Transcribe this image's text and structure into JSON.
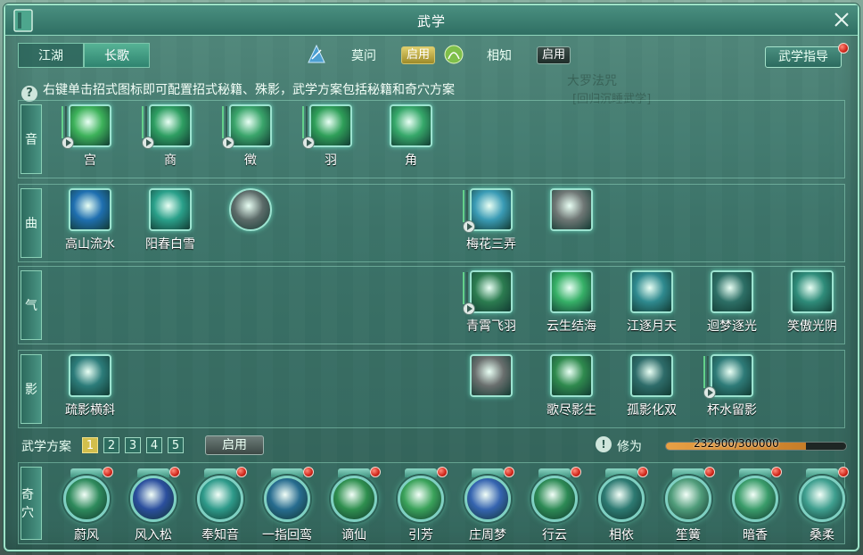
{
  "window": {
    "title": "武学"
  },
  "tabs": [
    {
      "label": "江湖",
      "active": false
    },
    {
      "label": "长歌",
      "active": true
    }
  ],
  "schools": [
    {
      "name": "莫问",
      "button": "启用",
      "state": "gold"
    },
    {
      "name": "相知",
      "button": "启用",
      "state": "dark"
    }
  ],
  "guide_button": "武学指导",
  "hint": "右键单击招式图标即可配置招式秘籍、殊影，武学方案包括秘籍和奇穴方案",
  "background_text": {
    "title": "大罗法咒",
    "subtitle": "[回归沉睡武学]"
  },
  "rows": [
    {
      "label": "音",
      "skills": [
        {
          "name": "宫",
          "icon": "hand-strum-icon",
          "color": "#3db25a"
        },
        {
          "name": "商",
          "icon": "hand-swirl-icon",
          "color": "#2e9e62"
        },
        {
          "name": "徵",
          "icon": "hand-pluck-icon",
          "color": "#3aa56b"
        },
        {
          "name": "羽",
          "icon": "hand-cross-icon",
          "color": "#2f9f59"
        },
        {
          "name": "角",
          "icon": "hand-open-icon",
          "color": "#36a86a"
        }
      ]
    },
    {
      "label": "曲",
      "skills": [
        {
          "name": "高山流水",
          "icon": "water-flow-icon",
          "color": "#1f6fb0"
        },
        {
          "name": "阳春白雪",
          "icon": "snowflake-icon",
          "color": "#2aa08a"
        },
        {
          "name": "",
          "icon": "smoke-orb-icon",
          "color": "#5c6b69"
        },
        {
          "name": "梅花三弄",
          "icon": "plum-blossom-icon",
          "color": "#3a9bb5"
        },
        {
          "name": "",
          "icon": "statue-icon",
          "color": "#6f7775"
        }
      ]
    },
    {
      "label": "气",
      "skills": [
        {
          "name": "青霄飞羽",
          "icon": "feather-icon",
          "color": "#2c7c50"
        },
        {
          "name": "云生结海",
          "icon": "green-vortex-icon",
          "color": "#36b067"
        },
        {
          "name": "江逐月天",
          "icon": "moon-burst-icon",
          "color": "#2f8a8f"
        },
        {
          "name": "迴梦逐光",
          "icon": "dream-figure-icon",
          "color": "#2d6f66"
        },
        {
          "name": "笑傲光阴",
          "icon": "wind-slash-icon",
          "color": "#2f8c7a"
        }
      ]
    },
    {
      "label": "影",
      "skills": [
        {
          "name": "疏影横斜",
          "icon": "shadow-runner-icon",
          "color": "#2c7c7a"
        },
        {
          "name": "",
          "icon": "grey-runner-icon",
          "color": "#6a6f6e"
        },
        {
          "name": "歌尽影生",
          "icon": "green-slash-icon",
          "color": "#2f8a4e"
        },
        {
          "name": "孤影化双",
          "icon": "twin-shadow-icon",
          "color": "#2e6c6a"
        },
        {
          "name": "杯水留影",
          "icon": "heart-ripple-icon",
          "color": "#2e7b78"
        }
      ]
    }
  ],
  "plan": {
    "label": "武学方案",
    "numbers": [
      "1",
      "2",
      "3",
      "4",
      "5"
    ],
    "active": "1",
    "enable": "启用"
  },
  "xiuwei": {
    "label": "修为",
    "current": 232900,
    "max": 300000,
    "text": "232900/300000",
    "fraction": 0.776
  },
  "qixue": {
    "label": "奇穴",
    "items": [
      {
        "name": "蔚风",
        "icon": "green-figure-icon",
        "color": "#2e8a5c"
      },
      {
        "name": "风入松",
        "icon": "blue-warrior-icon",
        "color": "#2b4f9e"
      },
      {
        "name": "奉知音",
        "icon": "heart-glow-icon",
        "color": "#2e9a8a"
      },
      {
        "name": "一指回鸾",
        "icon": "comet-icon",
        "color": "#276c8f"
      },
      {
        "name": "谪仙",
        "icon": "green-swirl-icon",
        "color": "#2f8f4f"
      },
      {
        "name": "引芳",
        "icon": "leaf-swirl-icon",
        "color": "#3aa25a"
      },
      {
        "name": "庄周梦",
        "icon": "blue-hand-icon",
        "color": "#3564b0"
      },
      {
        "name": "行云",
        "icon": "cloud-spiral-icon",
        "color": "#2d8a55"
      },
      {
        "name": "相依",
        "icon": "figure-swirl-icon",
        "color": "#2d7a72"
      },
      {
        "name": "笙簧",
        "icon": "pink-flower-icon",
        "color": "#4f9c7a"
      },
      {
        "name": "暗香",
        "icon": "blossom-sparkle-icon",
        "color": "#3a9c6a"
      },
      {
        "name": "桑柔",
        "icon": "white-flower-icon",
        "color": "#3f9f8f"
      }
    ]
  },
  "colors": {
    "frame": "#9fe3c8",
    "panel": "#2a6e62",
    "accent_gold": "#d2bf4c",
    "progress": "#e7a045",
    "notification": "#d0261a"
  }
}
